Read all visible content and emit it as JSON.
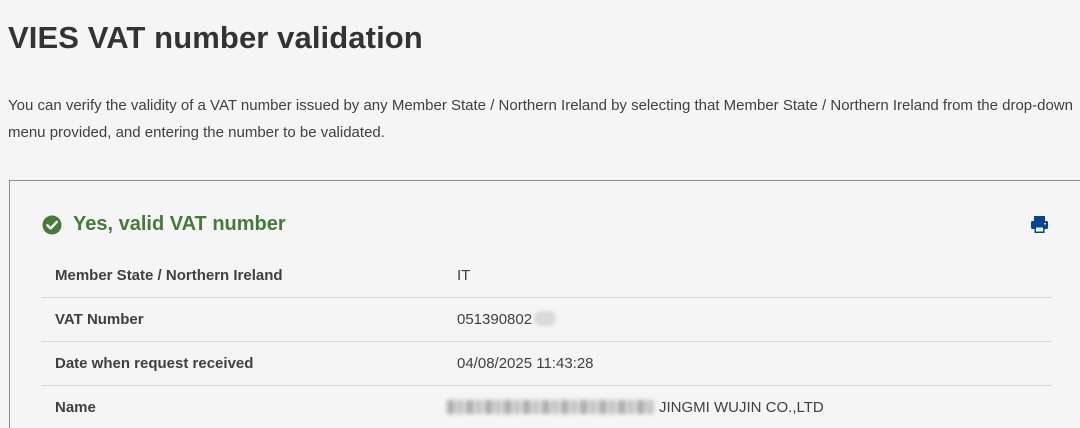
{
  "page": {
    "title": "VIES VAT number validation",
    "intro": "You can verify the validity of a VAT number issued by any Member State / Northern Ireland by selecting that Member State / Northern Ireland from the drop-down menu provided, and entering the number to be validated."
  },
  "result": {
    "status_text": "Yes, valid VAT number",
    "status_icon": "check-circle-icon",
    "print_icon": "print-icon",
    "status_color": "#467a39",
    "rows": [
      {
        "label": "Member State / Northern Ireland",
        "value": "IT"
      },
      {
        "label": "VAT Number",
        "value": "051390802"
      },
      {
        "label": "Date when request received",
        "value": "04/08/2025 11:43:28"
      },
      {
        "label": "Name",
        "value": "JINGMI WUJIN CO.,LTD"
      }
    ]
  }
}
